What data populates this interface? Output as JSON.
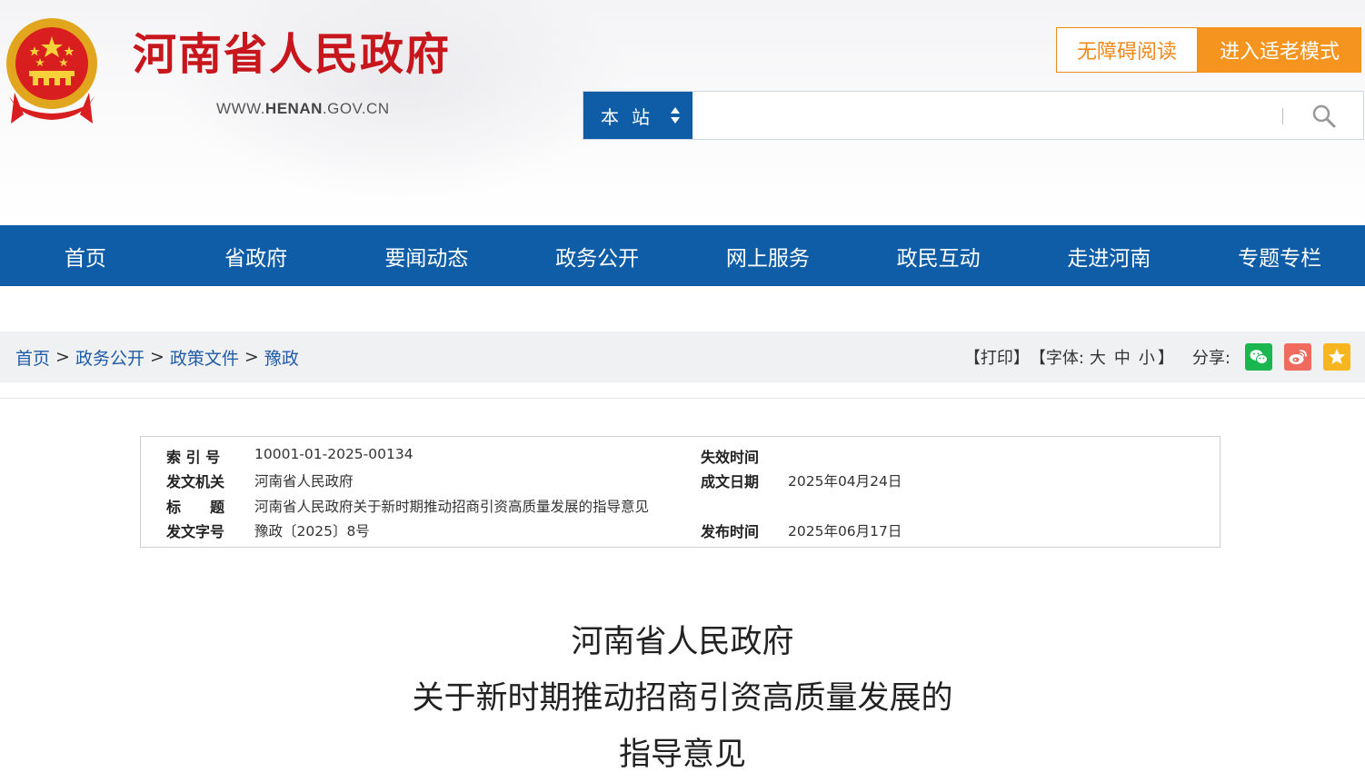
{
  "header": {
    "site_title": "河南省人民政府",
    "site_url_prefix": "WWW.",
    "site_url_bold": "HENAN",
    "site_url_suffix": ".GOV.CN",
    "accessibility_label": "无障碍阅读",
    "elder_mode_label": "进入适老模式"
  },
  "search": {
    "scope_label": "本站",
    "placeholder": "",
    "icon": "search-icon"
  },
  "nav": {
    "items": [
      "首页",
      "省政府",
      "要闻动态",
      "政务公开",
      "网上服务",
      "政民互动",
      "走进河南",
      "专题专栏"
    ]
  },
  "breadcrumb": {
    "items": [
      "首页",
      "政务公开",
      "政策文件",
      "豫政"
    ],
    "separator": ">"
  },
  "tools": {
    "print_label": "【打印】",
    "font_label": "【字体:",
    "font_large": "大",
    "font_medium": "中",
    "font_small": "小",
    "font_close": "】",
    "share_label": "分享:",
    "share_icons": [
      "wechat-icon",
      "weibo-icon",
      "favorite-icon"
    ]
  },
  "info": {
    "index_label": "索 引 号",
    "index_value": "10001-01-2025-00134",
    "expire_label": "失效时间",
    "expire_value": "",
    "issuer_label": "发文机关",
    "issuer_value": "河南省人民政府",
    "created_label": "成文日期",
    "created_value": "2025年04月24日",
    "title_label": "标　　题",
    "title_value": "河南省人民政府关于新时期推动招商引资高质量发展的指导意见",
    "docno_label": "发文字号",
    "docno_value": "豫政〔2025〕8号",
    "publish_label": "发布时间",
    "publish_value": "2025年06月17日"
  },
  "document": {
    "title_line1": "河南省人民政府",
    "title_line2": "关于新时期推动招商引资高质量发展的",
    "title_line3": "指导意见"
  },
  "colors": {
    "brand_red": "#c8161d",
    "nav_blue": "#0f5da7",
    "accent_orange": "#f5951f"
  }
}
